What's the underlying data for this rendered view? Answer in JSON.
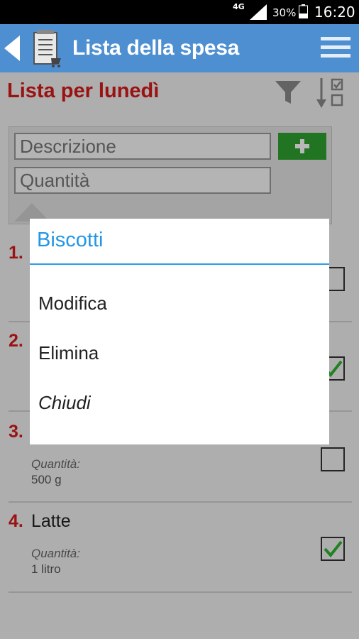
{
  "status_bar": {
    "network": "4G",
    "battery_text": "30%",
    "time": "16:20"
  },
  "app_bar": {
    "title": "Lista della spesa",
    "icons": [
      "back-icon",
      "shopping-list-icon",
      "menu-icon"
    ]
  },
  "list": {
    "title": "Lista per lunedì",
    "toolbar_icons": [
      "filter-icon",
      "sort-icon"
    ]
  },
  "add_form": {
    "description_placeholder": "Descrizione",
    "quantity_placeholder": "Quantità",
    "add_icon": "plus-icon"
  },
  "items": [
    {
      "number": "1.",
      "name": "",
      "quantity_label": "",
      "quantity": "",
      "checked": false
    },
    {
      "number": "2.",
      "name": "",
      "quantity_label": "",
      "quantity": "",
      "checked": true
    },
    {
      "number": "3.",
      "name": "",
      "quantity_label": "Quantità:",
      "quantity": "500 g",
      "checked": false
    },
    {
      "number": "4.",
      "name": "Latte",
      "quantity_label": "Quantità:",
      "quantity": "1 litro",
      "checked": true
    }
  ],
  "dialog": {
    "title": "Biscotti",
    "options": [
      "Modifica",
      "Elimina",
      "Chiudi"
    ]
  },
  "colors": {
    "app_bar": "#4e8fd2",
    "list_title": "#d61a1a",
    "add_button": "#2ea12e",
    "check": "#2db52d",
    "dialog_title": "#2196e8"
  }
}
